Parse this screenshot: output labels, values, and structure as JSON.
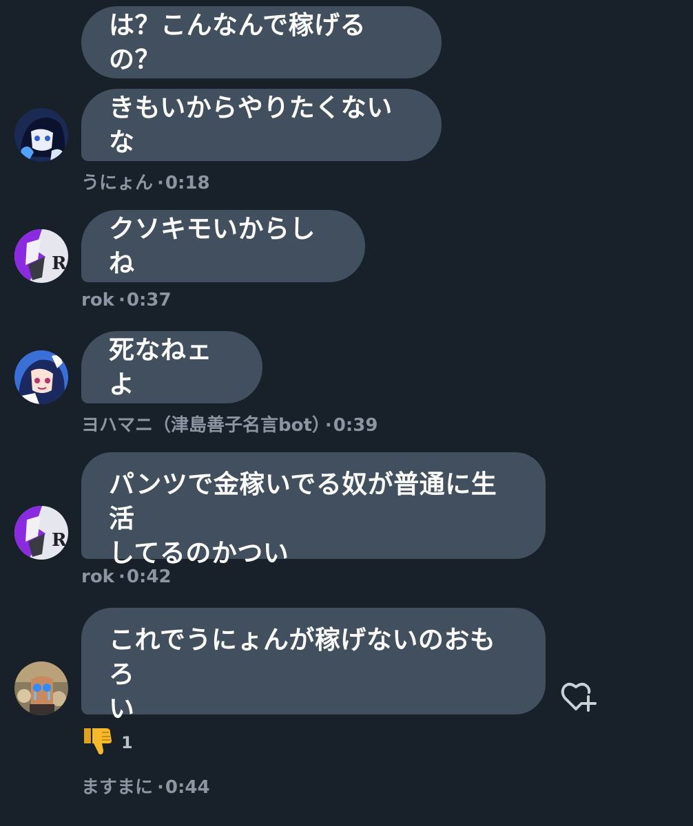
{
  "messages": [
    {
      "lines": [
        "は？こんなんで稼げるの？"
      ]
    },
    {
      "lines": [
        "きもいからやりたくないな"
      ],
      "author": "うにょん",
      "time": "0:18"
    },
    {
      "lines": [
        "クソキモいからしね"
      ],
      "author": "rok",
      "time": "0:37"
    },
    {
      "lines": [
        "死なねェよ"
      ],
      "author": "ヨハマニ（津島善子名言bot）",
      "time": "0:39"
    },
    {
      "lines": [
        "パンツで金稼いでる奴が普通に生活",
        "してるのかつい"
      ],
      "author": "rok",
      "time": "0:42"
    },
    {
      "lines": [
        "これでうにょんが稼げないのおもろ",
        "い"
      ],
      "author": "ますまに",
      "time": "0:44"
    }
  ],
  "reaction": {
    "emoji_icon": "thumbs-down-icon",
    "count": "1"
  },
  "meta_separator": "·",
  "colors": {
    "background": "#18202a",
    "bubble": "#424f5e",
    "meta_text": "#8b96a2",
    "bubble_text": "#ffffff"
  }
}
